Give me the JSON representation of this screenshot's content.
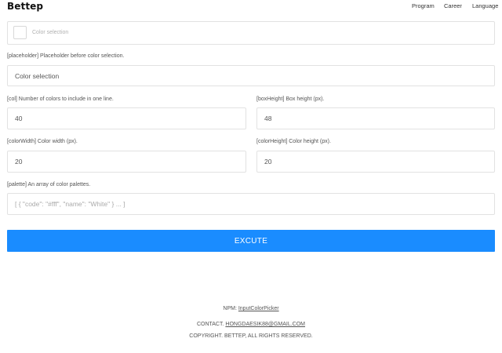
{
  "header": {
    "brand": "Bettep",
    "nav": [
      "Program",
      "Career",
      "Language"
    ]
  },
  "picker": {
    "text": "Color selection",
    "swatch_color": "#ffffff"
  },
  "fields": {
    "placeholder": {
      "label": "[placeholder] Placeholder before color selection.",
      "value": "Color selection"
    },
    "col": {
      "label": "[col] Number of colors to include in one line.",
      "value": "40"
    },
    "boxHeight": {
      "label": "[boxHeight] Box height (px).",
      "value": "48"
    },
    "colorWidth": {
      "label": "[colorWidth] Color width (px).",
      "value": "20"
    },
    "colorHeight": {
      "label": "[colorHeight] Color height (px).",
      "value": "20"
    },
    "palette": {
      "label": "[palette] An array of color palettes.",
      "placeholder": "[ { \"code\": \"#fff\", \"name\": \"White\" } ... ]"
    }
  },
  "button": {
    "label": "EXCUTE",
    "color": "#1a8cff"
  },
  "footer": {
    "npm_prefix": "NPM:",
    "npm_link": "InputColorPicker",
    "contact_prefix": "CONTACT.",
    "contact_email": "HONGDAESIK88@GMAIL.COM",
    "copyright": "COPYRIGHT. BETTEP, ALL RIGHTS RESERVED."
  }
}
